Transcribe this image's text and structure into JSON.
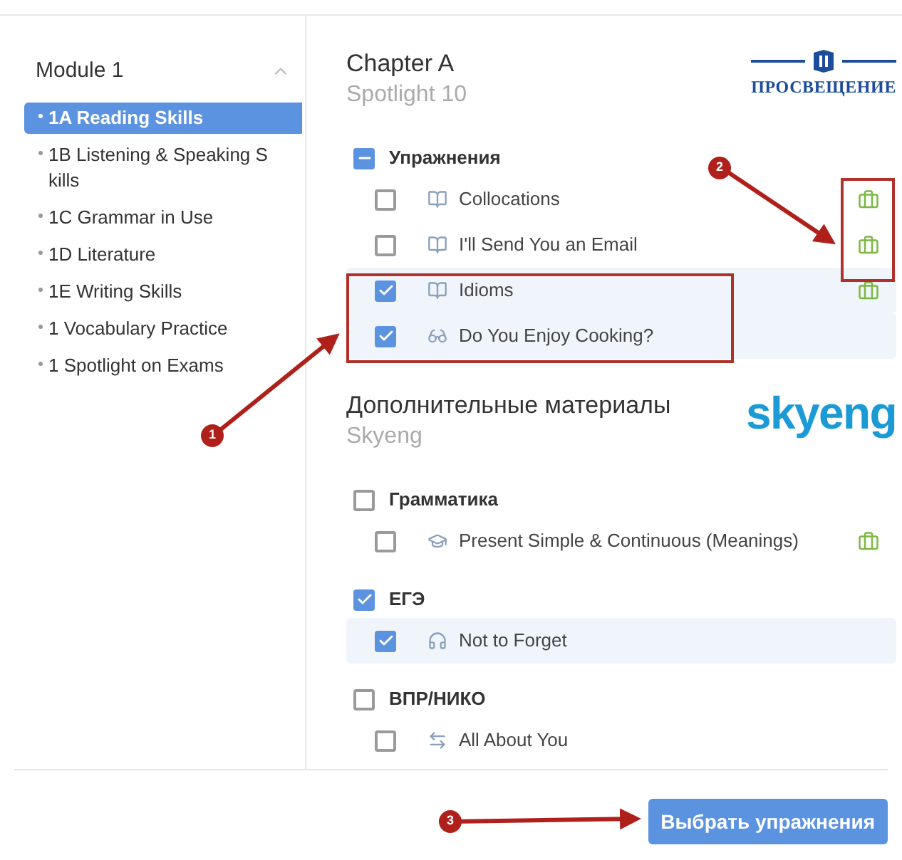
{
  "sidebar": {
    "module": {
      "title": "Module 1",
      "expanded": true
    },
    "items": [
      {
        "label": "1A Reading Skills",
        "selected": true
      },
      {
        "label": "1B Listening & Speaking S kills",
        "selected": false
      },
      {
        "label": "1C Grammar in Use",
        "selected": false
      },
      {
        "label": "1D Literature",
        "selected": false
      },
      {
        "label": "1E Writing Skills",
        "selected": false
      },
      {
        "label": "1 Vocabulary Practice",
        "selected": false
      },
      {
        "label": "1 Spotlight on Exams",
        "selected": false
      }
    ]
  },
  "sections": [
    {
      "title": "Chapter A",
      "subtitle": "Spotlight 10",
      "logo": {
        "kind": "prosveshchenie",
        "text": "ПРОСВЕЩЕНИЕ"
      },
      "groups": [
        {
          "label": "Упражнения",
          "kind": "partial",
          "items": [
            {
              "label": "Collocations",
              "kind": "book",
              "checked": false,
              "task": true
            },
            {
              "label": "I'll Send You an Email",
              "kind": "book",
              "checked": false,
              "task": true
            },
            {
              "label": "Idioms",
              "kind": "book",
              "checked": true,
              "task": true
            },
            {
              "label": "Do You Enjoy Cooking?",
              "kind": "glasses",
              "checked": true,
              "task": false
            }
          ]
        }
      ]
    },
    {
      "title": "Дополнительные материалы",
      "subtitle": "Skyeng",
      "logo": {
        "kind": "skyeng",
        "text": "skyeng"
      },
      "groups": [
        {
          "label": "Грамматика",
          "kind": "unchecked",
          "items": [
            {
              "label": "Present Simple & Continuous (Meanings)",
              "kind": "cap",
              "checked": false,
              "task": true
            }
          ]
        },
        {
          "label": "ЕГЭ",
          "kind": "checked",
          "items": [
            {
              "label": "Not to Forget",
              "kind": "headphones",
              "checked": true,
              "task": false
            }
          ]
        },
        {
          "label": "ВПР/НИКО",
          "kind": "unchecked",
          "items": [
            {
              "label": "All About You",
              "kind": "arrows",
              "checked": false,
              "task": false
            }
          ]
        }
      ]
    }
  ],
  "footer": {
    "button": "Выбрать упражнения"
  },
  "annotations": [
    {
      "label": "1"
    },
    {
      "label": "2"
    },
    {
      "label": "3"
    }
  ]
}
